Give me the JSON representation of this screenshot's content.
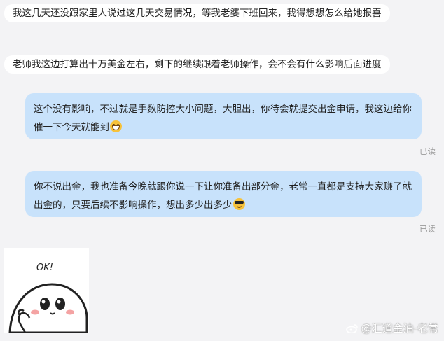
{
  "messages": [
    {
      "side": "incoming",
      "text": "我这几天还没跟家里人说过这几天交易情况，等我老婆下班回来，我得想想怎么给她报喜"
    },
    {
      "side": "incoming",
      "text": "老师我这边打算出十万美金左右，剩下的继续跟着老师操作，会不会有什么影响后面进度"
    },
    {
      "side": "outgoing",
      "text": "这个没有影响，不过就是手数防控大小问题，大胆出，你待会就提交出金申请，我这边给你催一下今天就能到",
      "emoji": "grinning-face-emoji",
      "status": "已读"
    },
    {
      "side": "outgoing",
      "text": "你不说出金，我也准备今晚就跟你说一下让你准备出部分金，老常一直都是支持大家赚了就出金的，只要后续不影响操作，想出多少出多少",
      "emoji": "sunglasses-face-emoji",
      "status": "已读"
    }
  ],
  "sticker": {
    "text": "OK!"
  },
  "watermark": {
    "text": "@汇道金油-老常"
  }
}
